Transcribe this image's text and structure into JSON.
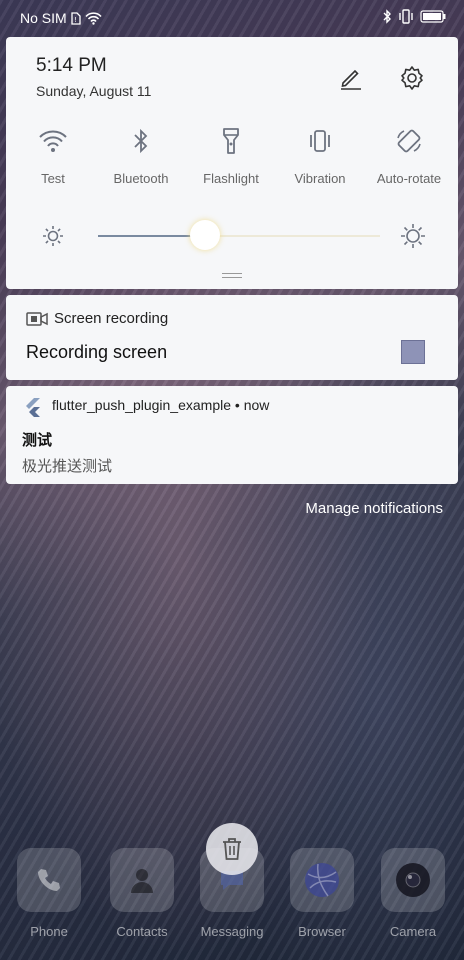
{
  "status_bar": {
    "carrier": "No SIM",
    "icons": [
      "sim-card-icon",
      "wifi-icon",
      "bluetooth-icon",
      "vibration-icon",
      "battery-icon"
    ]
  },
  "quick_settings": {
    "time": "5:14 PM",
    "date": "Sunday, August 11",
    "edit_icon": "edit-pen-icon",
    "settings_icon": "gear-icon",
    "toggles": [
      {
        "label": "Test",
        "icon": "wifi-icon"
      },
      {
        "label": "Bluetooth",
        "icon": "bluetooth-icon"
      },
      {
        "label": "Flashlight",
        "icon": "flashlight-icon"
      },
      {
        "label": "Vibration",
        "icon": "vibration-icon"
      },
      {
        "label": "Auto-rotate",
        "icon": "auto-rotate-icon"
      }
    ],
    "brightness_fraction": 0.38,
    "accent": "#7a8aa0"
  },
  "notifications": {
    "recording": {
      "app": "Screen recording",
      "title": "Recording screen",
      "icon": "screen-record-icon",
      "stop_color": "#8e93b7"
    },
    "push": {
      "header": "flutter_push_plugin_example • now",
      "title": "测试",
      "body": "极光推送测试",
      "icon": "flutter-icon"
    }
  },
  "manage_label": "Manage notifications",
  "dock": {
    "apps": [
      {
        "label": "Phone",
        "icon": "phone-icon"
      },
      {
        "label": "Contacts",
        "icon": "contacts-icon"
      },
      {
        "label": "Messaging",
        "icon": "messaging-icon"
      },
      {
        "label": "Browser",
        "icon": "browser-icon"
      },
      {
        "label": "Camera",
        "icon": "camera-icon"
      }
    ]
  }
}
